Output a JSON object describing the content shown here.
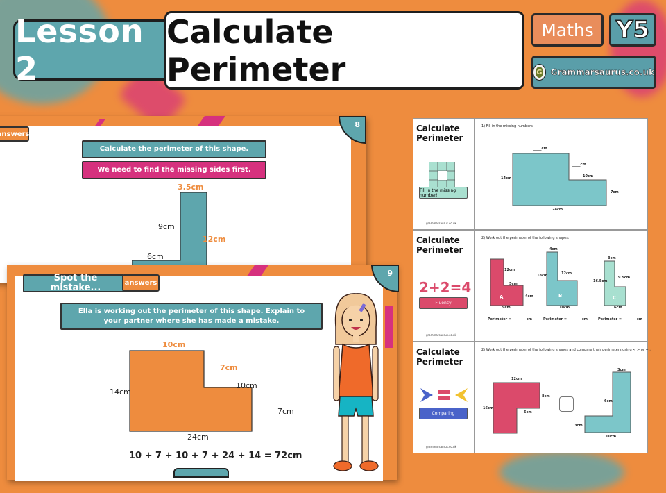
{
  "header": {
    "lesson_label": "Lesson 2",
    "title": "Calculate Perimeter",
    "subject": "Maths",
    "year": "Y5",
    "brand": "Grammarsaurus.co.uk",
    "brand_logo_icon": "dinosaur-logo-icon"
  },
  "colors": {
    "background_orange": "#ee8c3e",
    "teal": "#5ea6ad",
    "pink": "#d6317e",
    "worksheet_teal": "#7cc6c9",
    "worksheet_red": "#db4a6b",
    "worksheet_mint": "#a8e0d0"
  },
  "slide8": {
    "number": "8",
    "answers_label": "answers",
    "instruction": "Calculate the perimeter of this shape.",
    "hint": "We need to find the missing sides first.",
    "labels": {
      "top": "3.5cm",
      "left_upper": "9cm",
      "right": "12cm",
      "left_step": "6cm"
    }
  },
  "slide9": {
    "number": "9",
    "heading": "Spot the mistake...",
    "answers_label": "answers",
    "prompt": "Ella is working out the perimeter of this shape. Explain to your partner where she has made a mistake.",
    "labels": {
      "top": "10cm",
      "inner_vertical": "7cm",
      "inner_horizontal": "10cm",
      "left": "14cm",
      "right": "7cm",
      "bottom": "24cm"
    },
    "equation": "10 + 7 + 10 + 7 + 24 + 14 = 72cm",
    "character": "girl-character-ella"
  },
  "worksheets": [
    {
      "title_line1": "Calculate",
      "title_line2": "Perimeter",
      "tag": "Fill in the missing number!",
      "tag_icon": "puzzle-icon",
      "question": "1)  Fill in the missing numbers:",
      "labels": {
        "top": "_____cm",
        "inner_vertical": "_____cm",
        "inner_horizontal": "10cm",
        "left": "14cm",
        "right": "7cm",
        "bottom": "24cm"
      },
      "footer": "grammarsaurus.co.uk"
    },
    {
      "title_line1": "Calculate",
      "title_line2": "Perimeter",
      "tag": "Fluency",
      "tag_icon": "2+2=4",
      "question": "2) Work out the perimeter of the following shapes:",
      "shapes": [
        {
          "name": "A",
          "labels": [
            "12cm",
            "5cm",
            "4cm",
            "9cm"
          ],
          "perimeter_label": "Perimeter = ________cm"
        },
        {
          "name": "B",
          "labels": [
            "4cm",
            "18cm",
            "12cm",
            "10cm"
          ],
          "perimeter_label": "Perimeter = ________cm"
        },
        {
          "name": "C",
          "labels": [
            "3cm",
            "16.5cm",
            "9.5cm",
            "6cm"
          ],
          "perimeter_label": "Perimeter = ________cm"
        }
      ],
      "footer": "grammarsaurus.co.uk"
    },
    {
      "title_line1": "Calculate",
      "title_line2": "Perimeter",
      "tag": "Comparing",
      "tag_icon": "compare-symbols-icon",
      "question": "2) Work out the perimeter of the following shapes and compare their perimeters using < > or = :",
      "left_shape_labels": [
        "12cm",
        "8cm",
        "16cm",
        "6cm"
      ],
      "right_shape_labels": [
        "3cm",
        "6cm",
        "3cm",
        "10cm"
      ],
      "footer": "grammarsaurus.co.uk"
    }
  ]
}
